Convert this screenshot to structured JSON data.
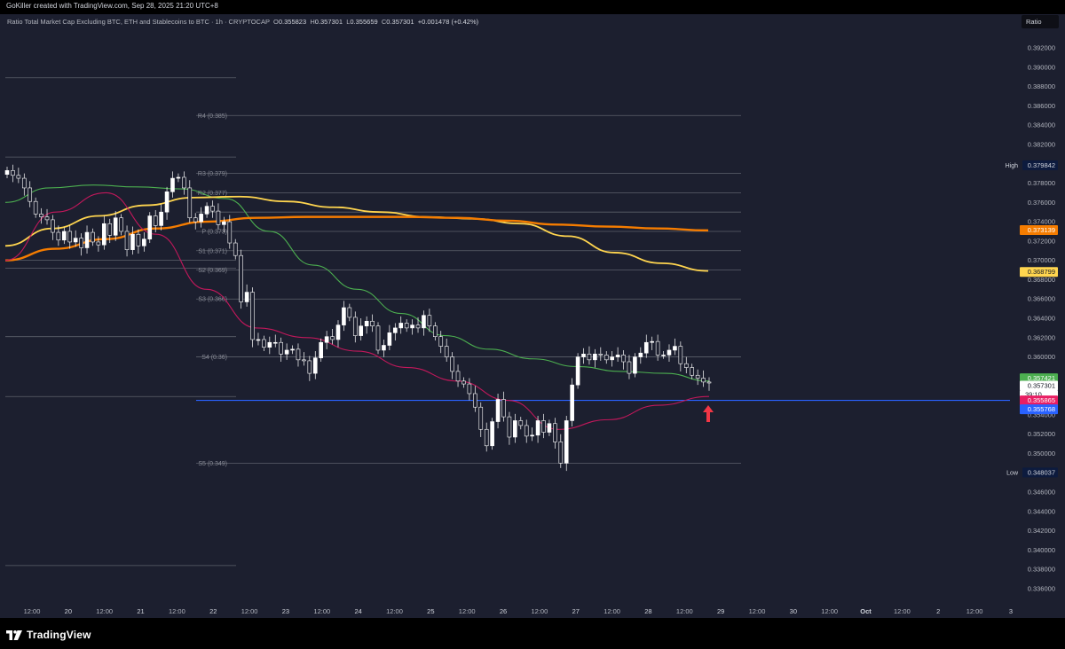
{
  "header": {
    "credit": "GoKiller created with TradingView.com, Sep 28, 2025 21:20 UTC+8"
  },
  "legend": {
    "title": "Ratio Total Market Cap Excluding BTC, ETH and Stablecoins to BTC · 1h · CRYPTOCAP",
    "o_label": "O",
    "o_value": "0.355823",
    "h_label": "H",
    "h_value": "0.357301",
    "l_label": "L",
    "l_value": "0.355659",
    "c_label": "C",
    "c_value": "0.357301",
    "change": "+0.001478 (+0.42%)"
  },
  "scale_badge": "Ratio",
  "footer": {
    "logo_text": "TradingView",
    "logo_icon": "tradingview-logo-icon"
  },
  "colors": {
    "background": "#1c1f2f",
    "up_candle": "#ffffff",
    "down_candle": "#1c1f2f",
    "wick": "#ffffff",
    "ma_green": "#4caf50",
    "ma_yellow": "#ffd54f",
    "ma_orange": "#f57c00",
    "ma_pink": "#c2185b",
    "current_line": "#2962ff",
    "pivot_lines": "#5d606b",
    "arrow": "#f23645"
  },
  "chart_data": {
    "type": "candlestick",
    "timeframe": "1h",
    "x_ticks": [
      "12:00",
      "20",
      "12:00",
      "21",
      "12:00",
      "22",
      "12:00",
      "23",
      "12:00",
      "24",
      "12:00",
      "25",
      "12:00",
      "26",
      "12:00",
      "27",
      "12:00",
      "28",
      "12:00",
      "29",
      "12:00",
      "30",
      "12:00",
      "Oct",
      "12:00",
      "2",
      "12:00",
      "3"
    ],
    "y_ticks": [
      "0.392000",
      "0.390000",
      "0.388000",
      "0.386000",
      "0.384000",
      "0.382000",
      "0.380000",
      "0.378000",
      "0.376000",
      "0.374000",
      "0.372000",
      "0.370000",
      "0.368000",
      "0.366000",
      "0.364000",
      "0.362000",
      "0.360000",
      "0.358000",
      "0.356000",
      "0.354000",
      "0.352000",
      "0.350000",
      "0.348000",
      "0.346000",
      "0.344000",
      "0.342000",
      "0.340000",
      "0.338000",
      "0.336000"
    ],
    "ylim": [
      0.335,
      0.393
    ],
    "pivot_levels": [
      {
        "label": "R4 (0.385)",
        "value": 0.385
      },
      {
        "label": "R3 (0.379)",
        "value": 0.379
      },
      {
        "label": "R2 (0.377)",
        "value": 0.377
      },
      {
        "label": "",
        "value": 0.375
      },
      {
        "label": "P (0.373)",
        "value": 0.373
      },
      {
        "label": "S1 (0.371)",
        "value": 0.371
      },
      {
        "label": "S2 (0.369)",
        "value": 0.369
      },
      {
        "label": "S3 (0.366)",
        "value": 0.366
      },
      {
        "label": "S4 (0.36)",
        "value": 0.36
      },
      {
        "label": "S5 (0.349)",
        "value": 0.349
      }
    ],
    "prior_pivot_levels": [
      0.3889,
      0.3807,
      0.37,
      0.3692,
      0.3621,
      0.3559,
      0.3384
    ],
    "current_price_line": 0.3555,
    "price_labels": [
      {
        "label": "High",
        "text": "0.379842",
        "value": 0.379842,
        "color": "#2962ff",
        "kind": "hl"
      },
      {
        "text": "0.373139",
        "value": 0.373139,
        "color": "#f57c00"
      },
      {
        "text": "0.368799",
        "value": 0.368799,
        "color": "#ffd54f"
      },
      {
        "text": "0.357421",
        "value": 0.357421,
        "color": "#4caf50"
      },
      {
        "text": "0.357301",
        "value": 0.357301,
        "color": "#ffffff",
        "sub": "39:10"
      },
      {
        "text": "0.355865",
        "value": 0.355865,
        "color": "#e91e63"
      },
      {
        "text": "0.355768",
        "value": 0.355768,
        "color": "#2962ff"
      },
      {
        "label": "Low",
        "text": "0.348037",
        "value": 0.348037,
        "color": "#2962ff",
        "kind": "hl"
      }
    ],
    "closes": [
      0.3793,
      0.3788,
      0.3785,
      0.3775,
      0.3761,
      0.3748,
      0.3745,
      0.3742,
      0.3729,
      0.3721,
      0.373,
      0.3719,
      0.3723,
      0.3713,
      0.3729,
      0.3719,
      0.3716,
      0.3738,
      0.3726,
      0.3744,
      0.373,
      0.3711,
      0.3727,
      0.3715,
      0.3722,
      0.3746,
      0.3736,
      0.375,
      0.3771,
      0.3785,
      0.3786,
      0.3775,
      0.3744,
      0.374,
      0.3748,
      0.3756,
      0.3751,
      0.3737,
      0.374,
      0.3718,
      0.3705,
      0.3657,
      0.3667,
      0.3618,
      0.3618,
      0.361,
      0.3615,
      0.3615,
      0.3603,
      0.3607,
      0.3608,
      0.3597,
      0.3596,
      0.3583,
      0.3599,
      0.3615,
      0.3621,
      0.3618,
      0.3633,
      0.3651,
      0.3641,
      0.3622,
      0.3632,
      0.3637,
      0.3632,
      0.3607,
      0.3612,
      0.3625,
      0.363,
      0.3635,
      0.363,
      0.3633,
      0.363,
      0.3643,
      0.3632,
      0.3621,
      0.3611,
      0.36,
      0.3585,
      0.3575,
      0.3572,
      0.3562,
      0.3548,
      0.3525,
      0.3508,
      0.3533,
      0.3556,
      0.3538,
      0.3517,
      0.3534,
      0.3529,
      0.3518,
      0.3519,
      0.3534,
      0.3522,
      0.3531,
      0.3512,
      0.349,
      0.3534,
      0.3571,
      0.36,
      0.3603,
      0.3597,
      0.3603,
      0.3602,
      0.3597,
      0.36,
      0.3602,
      0.3595,
      0.3583,
      0.36,
      0.3604,
      0.3615,
      0.3616,
      0.3602,
      0.3602,
      0.3607,
      0.3611,
      0.3593,
      0.3589,
      0.3581,
      0.3578,
      0.3574,
      0.3573
    ],
    "ma_series": [
      {
        "color": "#4caf50",
        "values": [
          0.376,
          0.3775,
          0.3778,
          0.3776,
          0.3774,
          0.3764,
          0.373,
          0.3695,
          0.367,
          0.3645,
          0.3622,
          0.3608,
          0.3598,
          0.359,
          0.3585,
          0.3583,
          0.3575
        ]
      },
      {
        "color": "#ffd54f",
        "values": [
          0.3715,
          0.3733,
          0.3746,
          0.3757,
          0.3765,
          0.3766,
          0.3761,
          0.3755,
          0.375,
          0.3745,
          0.3743,
          0.3738,
          0.3725,
          0.3708,
          0.3697,
          0.3689
        ]
      },
      {
        "color": "#f57c00",
        "values": [
          0.37,
          0.3712,
          0.3722,
          0.3733,
          0.374,
          0.3744,
          0.3745,
          0.3745,
          0.3745,
          0.3744,
          0.3741,
          0.3737,
          0.3735,
          0.3733,
          0.3731
        ]
      },
      {
        "color": "#c2185b",
        "values": [
          0.37,
          0.375,
          0.377,
          0.3727,
          0.367,
          0.363,
          0.362,
          0.3606,
          0.3589,
          0.3575,
          0.3555,
          0.3525,
          0.3535,
          0.355,
          0.3559
        ]
      }
    ]
  }
}
